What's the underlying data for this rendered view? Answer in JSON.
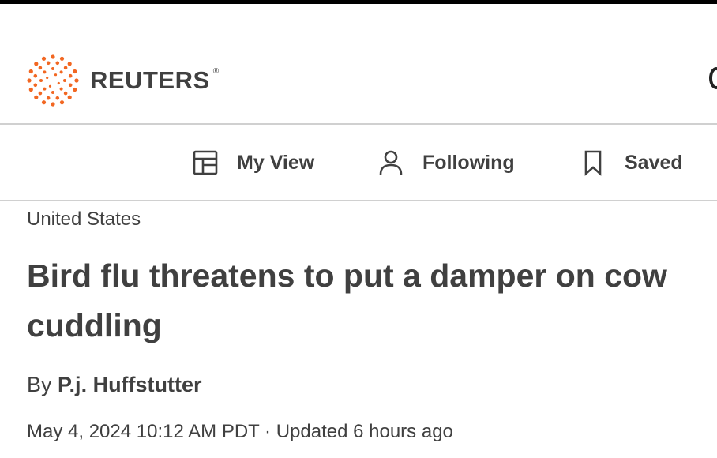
{
  "header": {
    "brand": "REUTERS",
    "registered_mark": "®",
    "brand_color": "#f26722"
  },
  "nav": {
    "items": [
      {
        "label": "My View",
        "icon": "layout-icon"
      },
      {
        "label": "Following",
        "icon": "person-icon"
      },
      {
        "label": "Saved",
        "icon": "bookmark-icon"
      }
    ]
  },
  "article": {
    "section": "United States",
    "headline": "Bird flu threatens to put a damper on cow cuddling",
    "byline_prefix": "By",
    "author": "P.j. Huffstutter",
    "dateline": "May 4, 2024 10:12 AM PDT · Updated 6 hours ago"
  }
}
